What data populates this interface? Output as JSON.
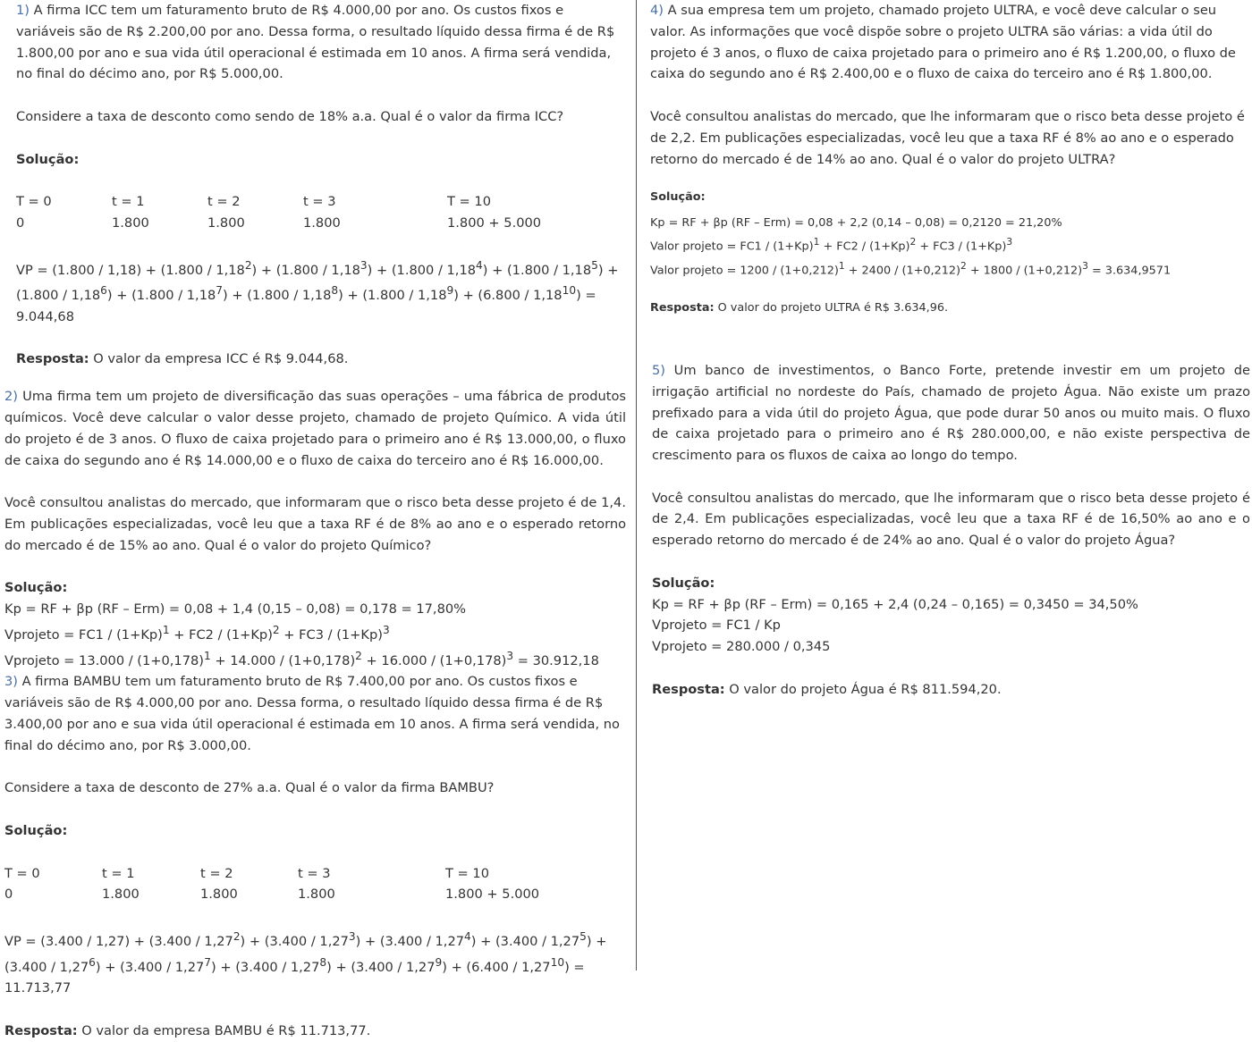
{
  "q1": {
    "num": "1)",
    "text": " A firma ICC tem um faturamento bruto de R$ 4.000,00 por ano. Os custos fixos e variáveis são de R$ 2.200,00 por ano. Dessa forma, o resultado líquido dessa firma é de R$ 1.800,00 por ano e sua vida útil operacional é estimada em 10 anos. A firma será vendida, no final do décimo ano, por R$ 5.000,00.",
    "question": "Considere a taxa de desconto como sendo de 18% a.a. Qual é o valor da firma ICC?",
    "sol_label": "Solução:",
    "table_head": [
      "T = 0",
      "t = 1",
      "t = 2",
      "t = 3",
      "T = 10"
    ],
    "table_vals": [
      "0",
      "1.800",
      "1.800",
      "1.800",
      "1.800 + 5.000"
    ],
    "vp_a": "VP = (1.800 / 1,18) + (1.800 / 1,18",
    "resp_label": "Resposta:",
    "resp_text": " O valor da empresa ICC é R$ 9.044,68."
  },
  "q2": {
    "num": "2)",
    "text": " Uma firma tem um projeto de diversificação das suas operações – uma fábrica de produtos químicos. Você deve calcular o valor desse projeto, chamado de projeto Químico. A vida útil do projeto é de 3 anos. O fluxo de caixa projetado para o primeiro ano é R$ 13.000,00, o fluxo de caixa do segundo ano é R$ 14.000,00 e o fluxo de caixa do terceiro ano é R$ 16.000,00.",
    "text2": "Você consultou analistas do mercado, que informaram que o risco beta desse projeto é de 1,4. Em publicações especializadas, você leu que a taxa RF é de 8% ao ano e o esperado retorno do mercado é de 15% ao ano. Qual é o valor do projeto Químico?",
    "sol_label": "Solução:",
    "kp": "Kp = RF + βp (RF – Erm) = 0,08 + 1,4 (0,15 – 0,08) = 0,178 = 17,80%"
  },
  "q3": {
    "num": "3)",
    "text": " A firma BAMBU tem um faturamento bruto de R$ 7.400,00 por ano. Os custos fixos e variáveis são de R$ 4.000,00 por ano. Dessa forma, o resultado líquido dessa firma é de R$ 3.400,00 por ano e sua vida útil operacional é estimada em 10 anos. A firma será vendida, no final do décimo ano, por R$ 3.000,00.",
    "question": "Considere a taxa de desconto de 27% a.a. Qual é o valor da firma BAMBU?",
    "sol_label": "Solução:",
    "table_head": [
      "T = 0",
      "t = 1",
      "t = 2",
      "t = 3",
      "T = 10"
    ],
    "table_vals": [
      "0",
      "1.800",
      "1.800",
      "1.800",
      "1.800 + 5.000"
    ],
    "resp_label": "Resposta:",
    "resp_text": " O valor da empresa BAMBU é R$ 11.713,77."
  },
  "q4": {
    "num": "4)",
    "text": " A sua empresa tem um projeto, chamado projeto ULTRA, e você deve calcular o seu valor. As informações que você dispõe sobre o projeto ULTRA são várias: a vida útil do projeto é 3 anos, o fluxo de caixa projetado para o primeiro ano é R$ 1.200,00, o fluxo de caixa do segundo ano é R$ 2.400,00 e o fluxo de caixa do terceiro ano é R$ 1.800,00.",
    "text2": "Você consultou analistas do mercado, que lhe informaram que o risco beta desse projeto é de 2,2. Em publicações especializadas, você leu que a taxa RF é 8% ao ano e o esperado retorno do mercado é de 14% ao ano. Qual é o valor do projeto ULTRA?",
    "sol_label": "Solução:",
    "kp": "Kp = RF + βp (RF – Erm) = 0,08 + 2,2 (0,14 – 0,08) = 0,2120 = 21,20%",
    "resp_label": "Resposta:",
    "resp_text": " O valor do projeto ULTRA é R$ 3.634,96."
  },
  "q5": {
    "num": "5)",
    "text": " Um banco de investimentos, o Banco Forte, pretende investir em um projeto de irrigação artificial no nordeste do País, chamado de projeto Água. Não existe um prazo prefixado para a vida útil do projeto Água, que pode durar 50 anos ou muito mais. O fluxo de caixa projetado para o primeiro ano é R$ 280.000,00, e não existe perspectiva de crescimento para os fluxos de caixa ao longo do tempo.",
    "text2": "Você consultou analistas do mercado, que lhe informaram que o risco beta desse projeto é de 2,4. Em publicações especializadas, você leu que a taxa RF é de 16,50% ao ano e o esperado retorno do mercado é de 24% ao ano. Qual é o valor do projeto Água?",
    "sol_label": "Solução:",
    "kp": "Kp = RF + βp (RF – Erm) = 0,165 + 2,4 (0,24 – 0,165) = 0,3450 = 34,50%",
    "v1": "Vprojeto = FC1 / Kp",
    "v2": "Vprojeto = 280.000 / 0,345",
    "resp_label": "Resposta:",
    "resp_text": " O valor do projeto Água é R$ 811.594,20."
  }
}
